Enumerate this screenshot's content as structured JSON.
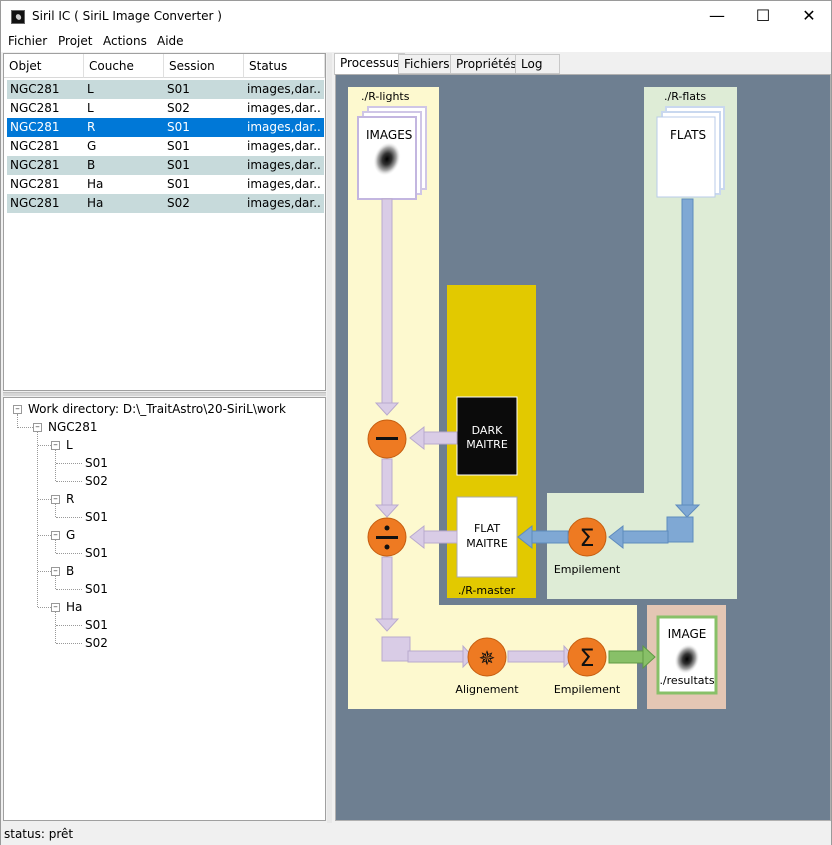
{
  "window": {
    "title": "Siril IC  ( SiriL Image Converter )",
    "minimize": "—",
    "maximize": "☐",
    "close": "✕"
  },
  "menu": [
    "Fichier",
    "Projet",
    "Actions",
    "Aide"
  ],
  "table": {
    "headers": [
      "Objet",
      "Couche",
      "Session",
      "Status"
    ],
    "rows": [
      [
        "NGC281",
        "L",
        "S01",
        "images,dar..."
      ],
      [
        "NGC281",
        "L",
        "S02",
        "images,dar..."
      ],
      [
        "NGC281",
        "R",
        "S01",
        "images,dar..."
      ],
      [
        "NGC281",
        "G",
        "S01",
        "images,dar..."
      ],
      [
        "NGC281",
        "B",
        "S01",
        "images,dar..."
      ],
      [
        "NGC281",
        "Ha",
        "S01",
        "images,dar..."
      ],
      [
        "NGC281",
        "Ha",
        "S02",
        "images,dar..."
      ]
    ],
    "selected_row": 2
  },
  "tree": {
    "root": "Work directory: D:\\_TraitAstro\\20-SiriL\\work",
    "object": "NGC281",
    "layers": [
      {
        "name": "L",
        "sessions": [
          "S01",
          "S02"
        ]
      },
      {
        "name": "R",
        "sessions": [
          "S01"
        ]
      },
      {
        "name": "G",
        "sessions": [
          "S01"
        ]
      },
      {
        "name": "B",
        "sessions": [
          "S01"
        ]
      },
      {
        "name": "Ha",
        "sessions": [
          "S01",
          "S02"
        ]
      }
    ]
  },
  "tabs": [
    "Processus",
    "Fichiers",
    "Propriétés",
    "Log"
  ],
  "active_tab": 0,
  "diagram": {
    "lights_label": "./R-lights",
    "flats_label": "./R-flats",
    "master_label": "./R-master",
    "images_label": "IMAGES",
    "flats_card": "FLATS",
    "dark_line1": "DARK",
    "dark_line2": "MAITRE",
    "flat_line1": "FLAT",
    "flat_line2": "MAITRE",
    "empilement_flats": "Empilement",
    "alignement": "Alignement",
    "empilement_final": "Empilement",
    "result_title": "IMAGE",
    "result_label": "./resultats",
    "colors": {
      "canvas": "#6e7f91",
      "lights_bg": "#fdf9cf",
      "flats_bg": "#deecd6",
      "master_bg": "#e2c900",
      "result_bg": "#e4c6b4",
      "lilac": "#d9cce6",
      "blue_arrow": "#7fa8d4",
      "green_arrow": "#88c068",
      "orange": "#ee7a22"
    }
  },
  "status": "status: prêt"
}
